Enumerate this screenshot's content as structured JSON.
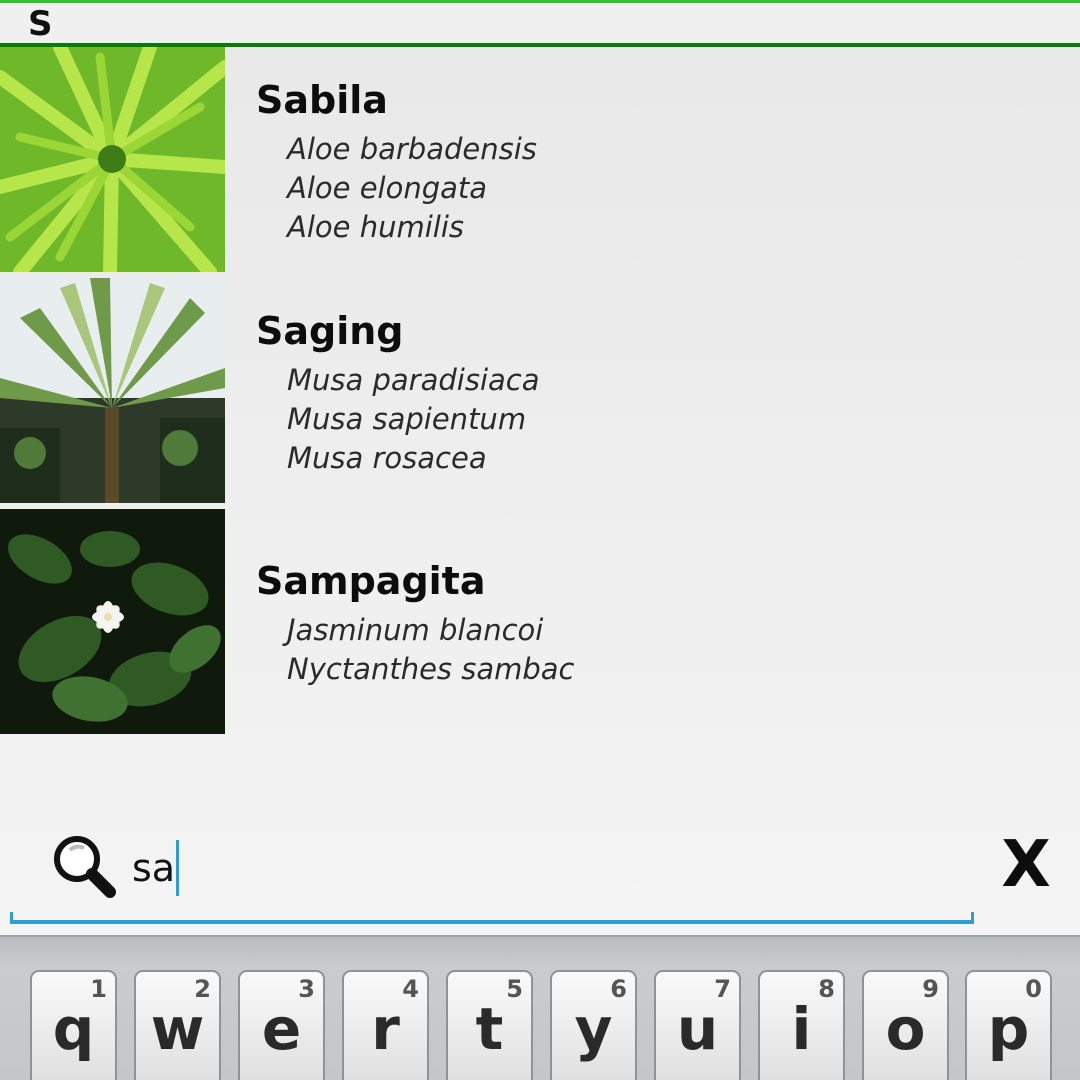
{
  "section_header": {
    "letter": "S"
  },
  "results": [
    {
      "common_name": "Sabila",
      "scientific_names": [
        "Aloe barbadensis",
        "Aloe elongata",
        "Aloe humilis"
      ]
    },
    {
      "common_name": "Saging",
      "scientific_names": [
        "Musa paradisiaca",
        "Musa sapientum",
        "Musa rosacea"
      ]
    },
    {
      "common_name": "Sampagita",
      "scientific_names": [
        "Jasminum blancoi",
        "Nyctanthes sambac"
      ]
    }
  ],
  "search": {
    "query": "sa",
    "clear_label": "X"
  },
  "keyboard": {
    "row1": [
      {
        "letter": "q",
        "hint": "1"
      },
      {
        "letter": "w",
        "hint": "2"
      },
      {
        "letter": "e",
        "hint": "3"
      },
      {
        "letter": "r",
        "hint": "4"
      },
      {
        "letter": "t",
        "hint": "5"
      },
      {
        "letter": "y",
        "hint": "6"
      },
      {
        "letter": "u",
        "hint": "7"
      },
      {
        "letter": "i",
        "hint": "8"
      },
      {
        "letter": "o",
        "hint": "9"
      },
      {
        "letter": "p",
        "hint": "0"
      }
    ]
  },
  "colors": {
    "header_top": "#2fc42f",
    "header_bottom": "#0a7a0a",
    "search_accent": "#2a9fd6"
  },
  "icons": {
    "search": "search-icon",
    "clear": "close-icon"
  }
}
